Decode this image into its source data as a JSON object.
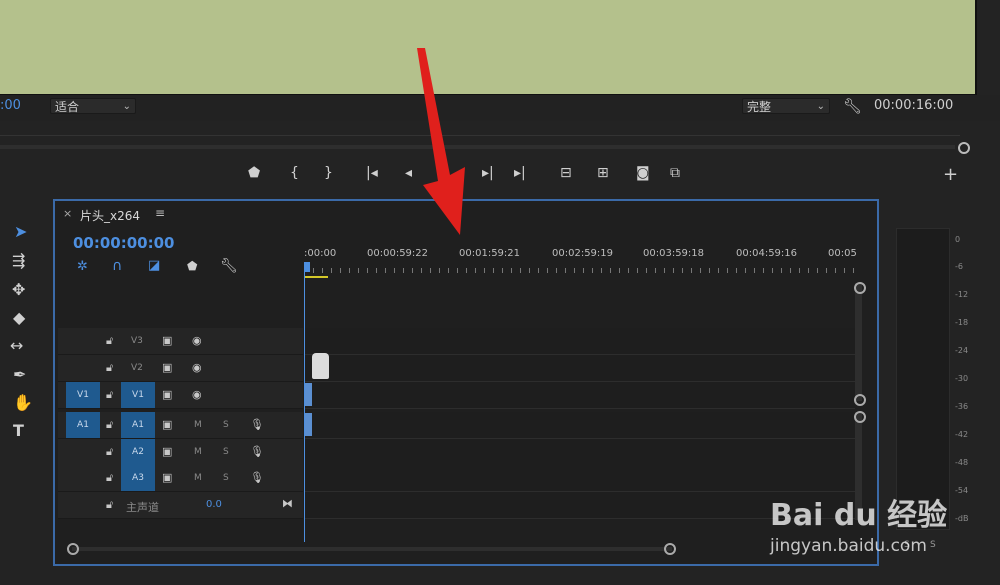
{
  "monitor": {
    "timecode_left": ":00",
    "fit_select": "适合",
    "quality_select": "完整",
    "duration": "00:00:16:00"
  },
  "icons": [
    "marker-icon",
    "mark-in-icon",
    "mark-out-icon",
    "go-to-in-icon",
    "step-back-icon",
    "play-icon",
    "step-forward-icon",
    "go-to-out-icon",
    "lift-icon",
    "extract-icon",
    "export-frame-icon",
    "comparison-view-icon",
    "add-button-icon",
    "wrench-icon"
  ],
  "timeline": {
    "close": "×",
    "sequence_name": "片头_x264",
    "menu": "≡",
    "timecode": "00:00:00:00",
    "ruler": [
      ":00:00",
      "00:00:59:22",
      "00:01:59:21",
      "00:02:59:19",
      "00:03:59:18",
      "00:04:59:16",
      "00:05"
    ],
    "video_tracks": [
      {
        "name": "V3",
        "source": ""
      },
      {
        "name": "V2",
        "source": ""
      },
      {
        "name": "V1",
        "source": "V1"
      }
    ],
    "audio_tracks": [
      {
        "name": "A1",
        "source": "A1",
        "m": "M",
        "s": "S"
      },
      {
        "name": "A2",
        "source": "",
        "m": "M",
        "s": "S"
      },
      {
        "name": "A3",
        "source": "",
        "m": "M",
        "s": "S"
      }
    ],
    "master": {
      "label": "主声道",
      "value": "0.0"
    }
  },
  "meters": {
    "labels": [
      "0",
      "-6",
      "-12",
      "-18",
      "-24",
      "-30",
      "-36",
      "-42",
      "-48",
      "-54",
      "-dB"
    ],
    "solo": [
      "S",
      "S"
    ]
  },
  "watermark": {
    "brand": "Bai du 经验",
    "url": "jingyan.baidu.com"
  },
  "colors": {
    "accent": "#4d8fe0",
    "monitor_bg": "#b4c18c",
    "arrow": "#e0201c",
    "track_target": "#1f5a8f"
  }
}
